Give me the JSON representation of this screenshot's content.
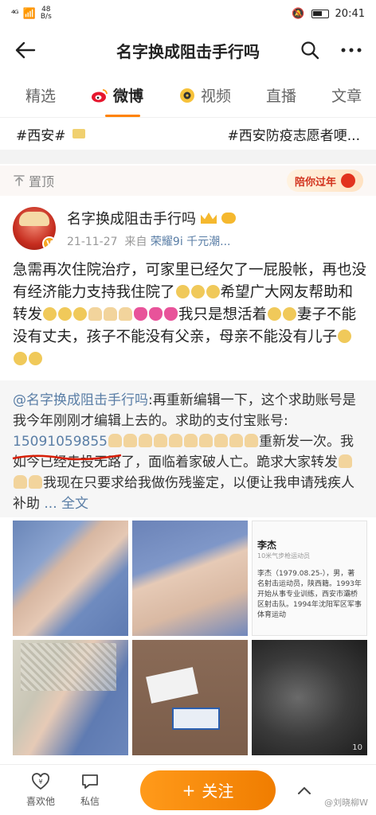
{
  "status_bar": {
    "signal": "⁴ᴳ",
    "speed_top": "48",
    "speed_bottom": "B/s",
    "time": "20:41"
  },
  "nav": {
    "title": "名字换成阻击手行吗"
  },
  "tabs": [
    {
      "label": "精选"
    },
    {
      "label": "微博"
    },
    {
      "label": "视频"
    },
    {
      "label": "直播"
    },
    {
      "label": "文章"
    }
  ],
  "hashtags": {
    "first": "#西安#",
    "second": "#西安防疫志愿者哽..."
  },
  "pinned": {
    "label": "置顶",
    "banner": "陪你过年"
  },
  "post": {
    "author_name": "名字换成阻击手行吗",
    "date": "21-11-27",
    "source_prefix": "来自",
    "device": "荣耀9i 千元潮...",
    "text_1": "急需再次住院治疗，可家里已经欠了一屁股帐，再也没有经济能力支持我住院了",
    "text_2": "希望广大网友帮助和转发",
    "text_3": "我只是想活着",
    "text_4": "妻子不能没有丈夫，孩子不能没有父亲，母亲不能没有儿子"
  },
  "quote": {
    "mention": "@名字换成阻击手行吗",
    "text_1": ":再重新编辑一下，这个求助账号是我今年刚刚才编辑上去的。求助的支付宝账号:",
    "phone": "15091059855",
    "text_2": "重新发一次。我如今已经走投无路了，面临着家破人亡。跪求大家转发",
    "text_3": "我现在只要求给我做伤残鉴定，以便让我申请残疾人补助",
    "more": "... 全文"
  },
  "photos": {
    "doc_name": "李杰",
    "doc_sub": "10米气步枪运动员",
    "doc_text": "李杰（1979.08.25-），男，著名射击运动员，陕西籍。1993年开始从事专业训练，西安市灞桥区射击队。1994年沈阳军区军事体育运动",
    "last_number": "10"
  },
  "bottom_bar": {
    "like_label": "喜欢他",
    "message_label": "私信",
    "follow_label": "关注",
    "watermark": "@刘晓柳W"
  }
}
